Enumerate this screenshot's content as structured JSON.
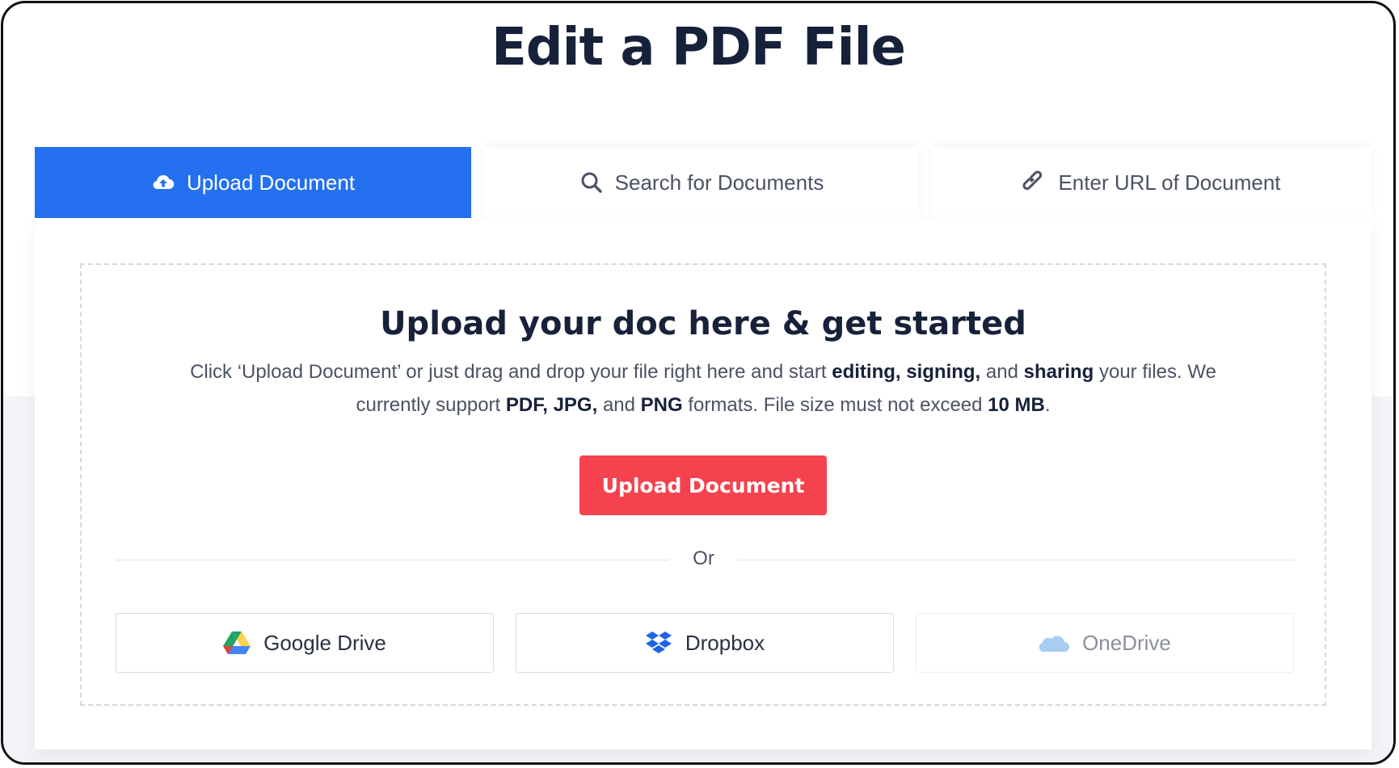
{
  "page": {
    "title": "Edit a PDF File"
  },
  "tabs": [
    {
      "label": "Upload Document",
      "icon": "cloud-upload-icon",
      "active": true
    },
    {
      "label": "Search for Documents",
      "icon": "search-icon",
      "active": false
    },
    {
      "label": "Enter URL of Document",
      "icon": "link-icon",
      "active": false
    }
  ],
  "upload": {
    "heading": "Upload your doc here & get started",
    "desc": {
      "p1": "Click ‘Upload Document’ or just drag and drop your file right here and start ",
      "b1": "editing,",
      "p2": " ",
      "b2": "signing,",
      "p3": " and ",
      "b3": "sharing",
      "p4": " your files. We currently support ",
      "b4": "PDF,",
      "p5": " ",
      "b5": "JPG,",
      "p6": " and ",
      "b6": "PNG",
      "p7": " formats. File size must not exceed ",
      "b7": "10 MB",
      "p8": "."
    },
    "button_label": "Upload Document",
    "button_color": "#f5424f",
    "or_label": "Or"
  },
  "providers": [
    {
      "label": "Google Drive",
      "icon": "google-drive-icon"
    },
    {
      "label": "Dropbox",
      "icon": "dropbox-icon"
    },
    {
      "label": "OneDrive",
      "icon": "onedrive-icon"
    }
  ],
  "colors": {
    "accent": "#2470f0",
    "title": "#17213a",
    "text": "#4b5262"
  }
}
